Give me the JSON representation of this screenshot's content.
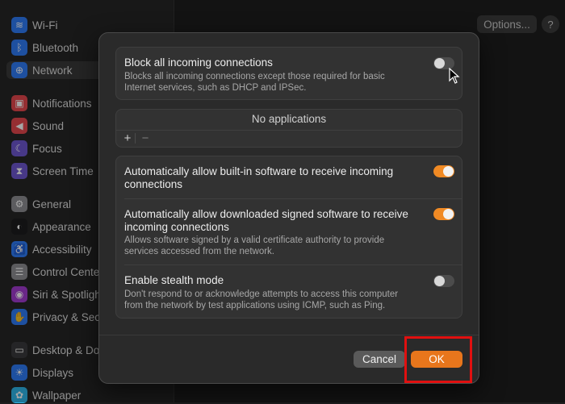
{
  "sidebar": {
    "items": [
      {
        "label": "Wi-Fi",
        "icon": "wifi-icon",
        "color": "#2f7cf6",
        "glyph": "≋"
      },
      {
        "label": "Bluetooth",
        "icon": "bluetooth-icon",
        "color": "#2f7cf6",
        "glyph": "ᛒ"
      },
      {
        "label": "Network",
        "icon": "globe-icon",
        "color": "#2f7cf6",
        "glyph": "⊕"
      },
      {
        "label": "Notifications",
        "icon": "bell-icon",
        "color": "#e5484d",
        "glyph": "▣"
      },
      {
        "label": "Sound",
        "icon": "speaker-icon",
        "color": "#e5484d",
        "glyph": "◀"
      },
      {
        "label": "Focus",
        "icon": "moon-icon",
        "color": "#6e56cf",
        "glyph": "☾"
      },
      {
        "label": "Screen Time",
        "icon": "hourglass-icon",
        "color": "#6e56cf",
        "glyph": "⧗"
      },
      {
        "label": "General",
        "icon": "gear-icon",
        "color": "#8e8e93",
        "glyph": "⚙"
      },
      {
        "label": "Appearance",
        "icon": "appearance-icon",
        "color": "#1c1c1e",
        "glyph": "◐"
      },
      {
        "label": "Accessibility",
        "icon": "accessibility-icon",
        "color": "#2f7cf6",
        "glyph": "♿"
      },
      {
        "label": "Control Cente",
        "icon": "control-center-icon",
        "color": "#8e8e93",
        "glyph": "☰"
      },
      {
        "label": "Siri & Spotligh",
        "icon": "siri-icon",
        "color": "#a23bcf",
        "glyph": "◉"
      },
      {
        "label": "Privacy & Sec",
        "icon": "hand-icon",
        "color": "#2f7cf6",
        "glyph": "✋"
      },
      {
        "label": "Desktop & Do",
        "icon": "desktop-icon",
        "color": "#3a3a3c",
        "glyph": "▭"
      },
      {
        "label": "Displays",
        "icon": "display-icon",
        "color": "#2f7cf6",
        "glyph": "☀"
      },
      {
        "label": "Wallpaper",
        "icon": "wallpaper-icon",
        "color": "#2fb5e8",
        "glyph": "✿"
      }
    ]
  },
  "toolbar": {
    "options_label": "Options...",
    "help_label": "?"
  },
  "dialog": {
    "block": {
      "title": "Block all incoming connections",
      "desc_line1": "Blocks all incoming connections except those required for basic",
      "desc_line2": "Internet services, such as DHCP and IPSec.",
      "enabled": false
    },
    "apps": {
      "empty_label": "No applications",
      "add_label": "+",
      "remove_label": "−"
    },
    "builtin": {
      "title_line1": "Automatically allow built-in software to receive incoming",
      "title_line2": "connections",
      "enabled": true
    },
    "signed": {
      "title_line1": "Automatically allow downloaded signed software to receive",
      "title_line2": "incoming connections",
      "desc_line1": "Allows software signed by a valid certificate authority to provide",
      "desc_line2": "services accessed from the network.",
      "enabled": true
    },
    "stealth": {
      "title": "Enable stealth mode",
      "desc_line1": "Don't respond to or acknowledge attempts to access this computer",
      "desc_line2": "from the network by test applications using ICMP, such as Ping.",
      "enabled": false
    },
    "cancel_label": "Cancel",
    "ok_label": "OK"
  },
  "colors": {
    "accent": "#e8761c",
    "highlight": "#e01010"
  }
}
